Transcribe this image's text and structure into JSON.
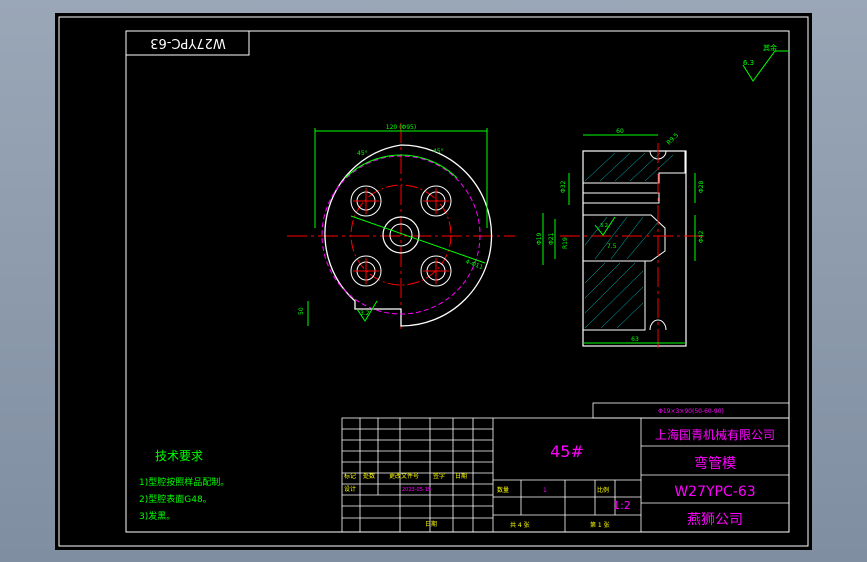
{
  "drawing": {
    "code_stamp": "W27YPC-63",
    "roughness_note": "其余",
    "roughness_value": "6.3",
    "material": "45#",
    "company": "上海国青机械有限公司",
    "part_name": "弯管模",
    "model": "W27YPC-63",
    "customer": "燕狮公司",
    "scale": "1:2",
    "bend_spec": "Φ19×3×90(50-60-90)",
    "tech_req_title": "技术要求",
    "tech_req": [
      "1)型腔按照样品配制。",
      "2)型腔表面G48。",
      "3)发黑。"
    ]
  },
  "dims": {
    "outer_dia": "120 (Φ95)",
    "angle_left": "45°",
    "angle_right": "45°",
    "holes": "4-Φ11",
    "flat": "50",
    "rough_a": "3.2",
    "rough_b": "3.2",
    "width": "60",
    "depth": "63",
    "d1": "Φ32",
    "d2": "Φ28",
    "d3": "Φ42",
    "d4": "Φ19",
    "d5": "Φ21",
    "d6": "R19",
    "d7": "7.5",
    "d8": "R9.5"
  },
  "title_block": {
    "row_labels": [
      "标记",
      "处数",
      "更改文件号",
      "签字",
      "日期"
    ],
    "row_labels2": [
      "设计",
      "",
      "2023-05-19",
      "",
      ""
    ],
    "cells": [
      "数量",
      "1",
      "比例"
    ],
    "sheet_labels": [
      "共 4 张",
      "第 1 张"
    ],
    "date_label": "日期"
  }
}
